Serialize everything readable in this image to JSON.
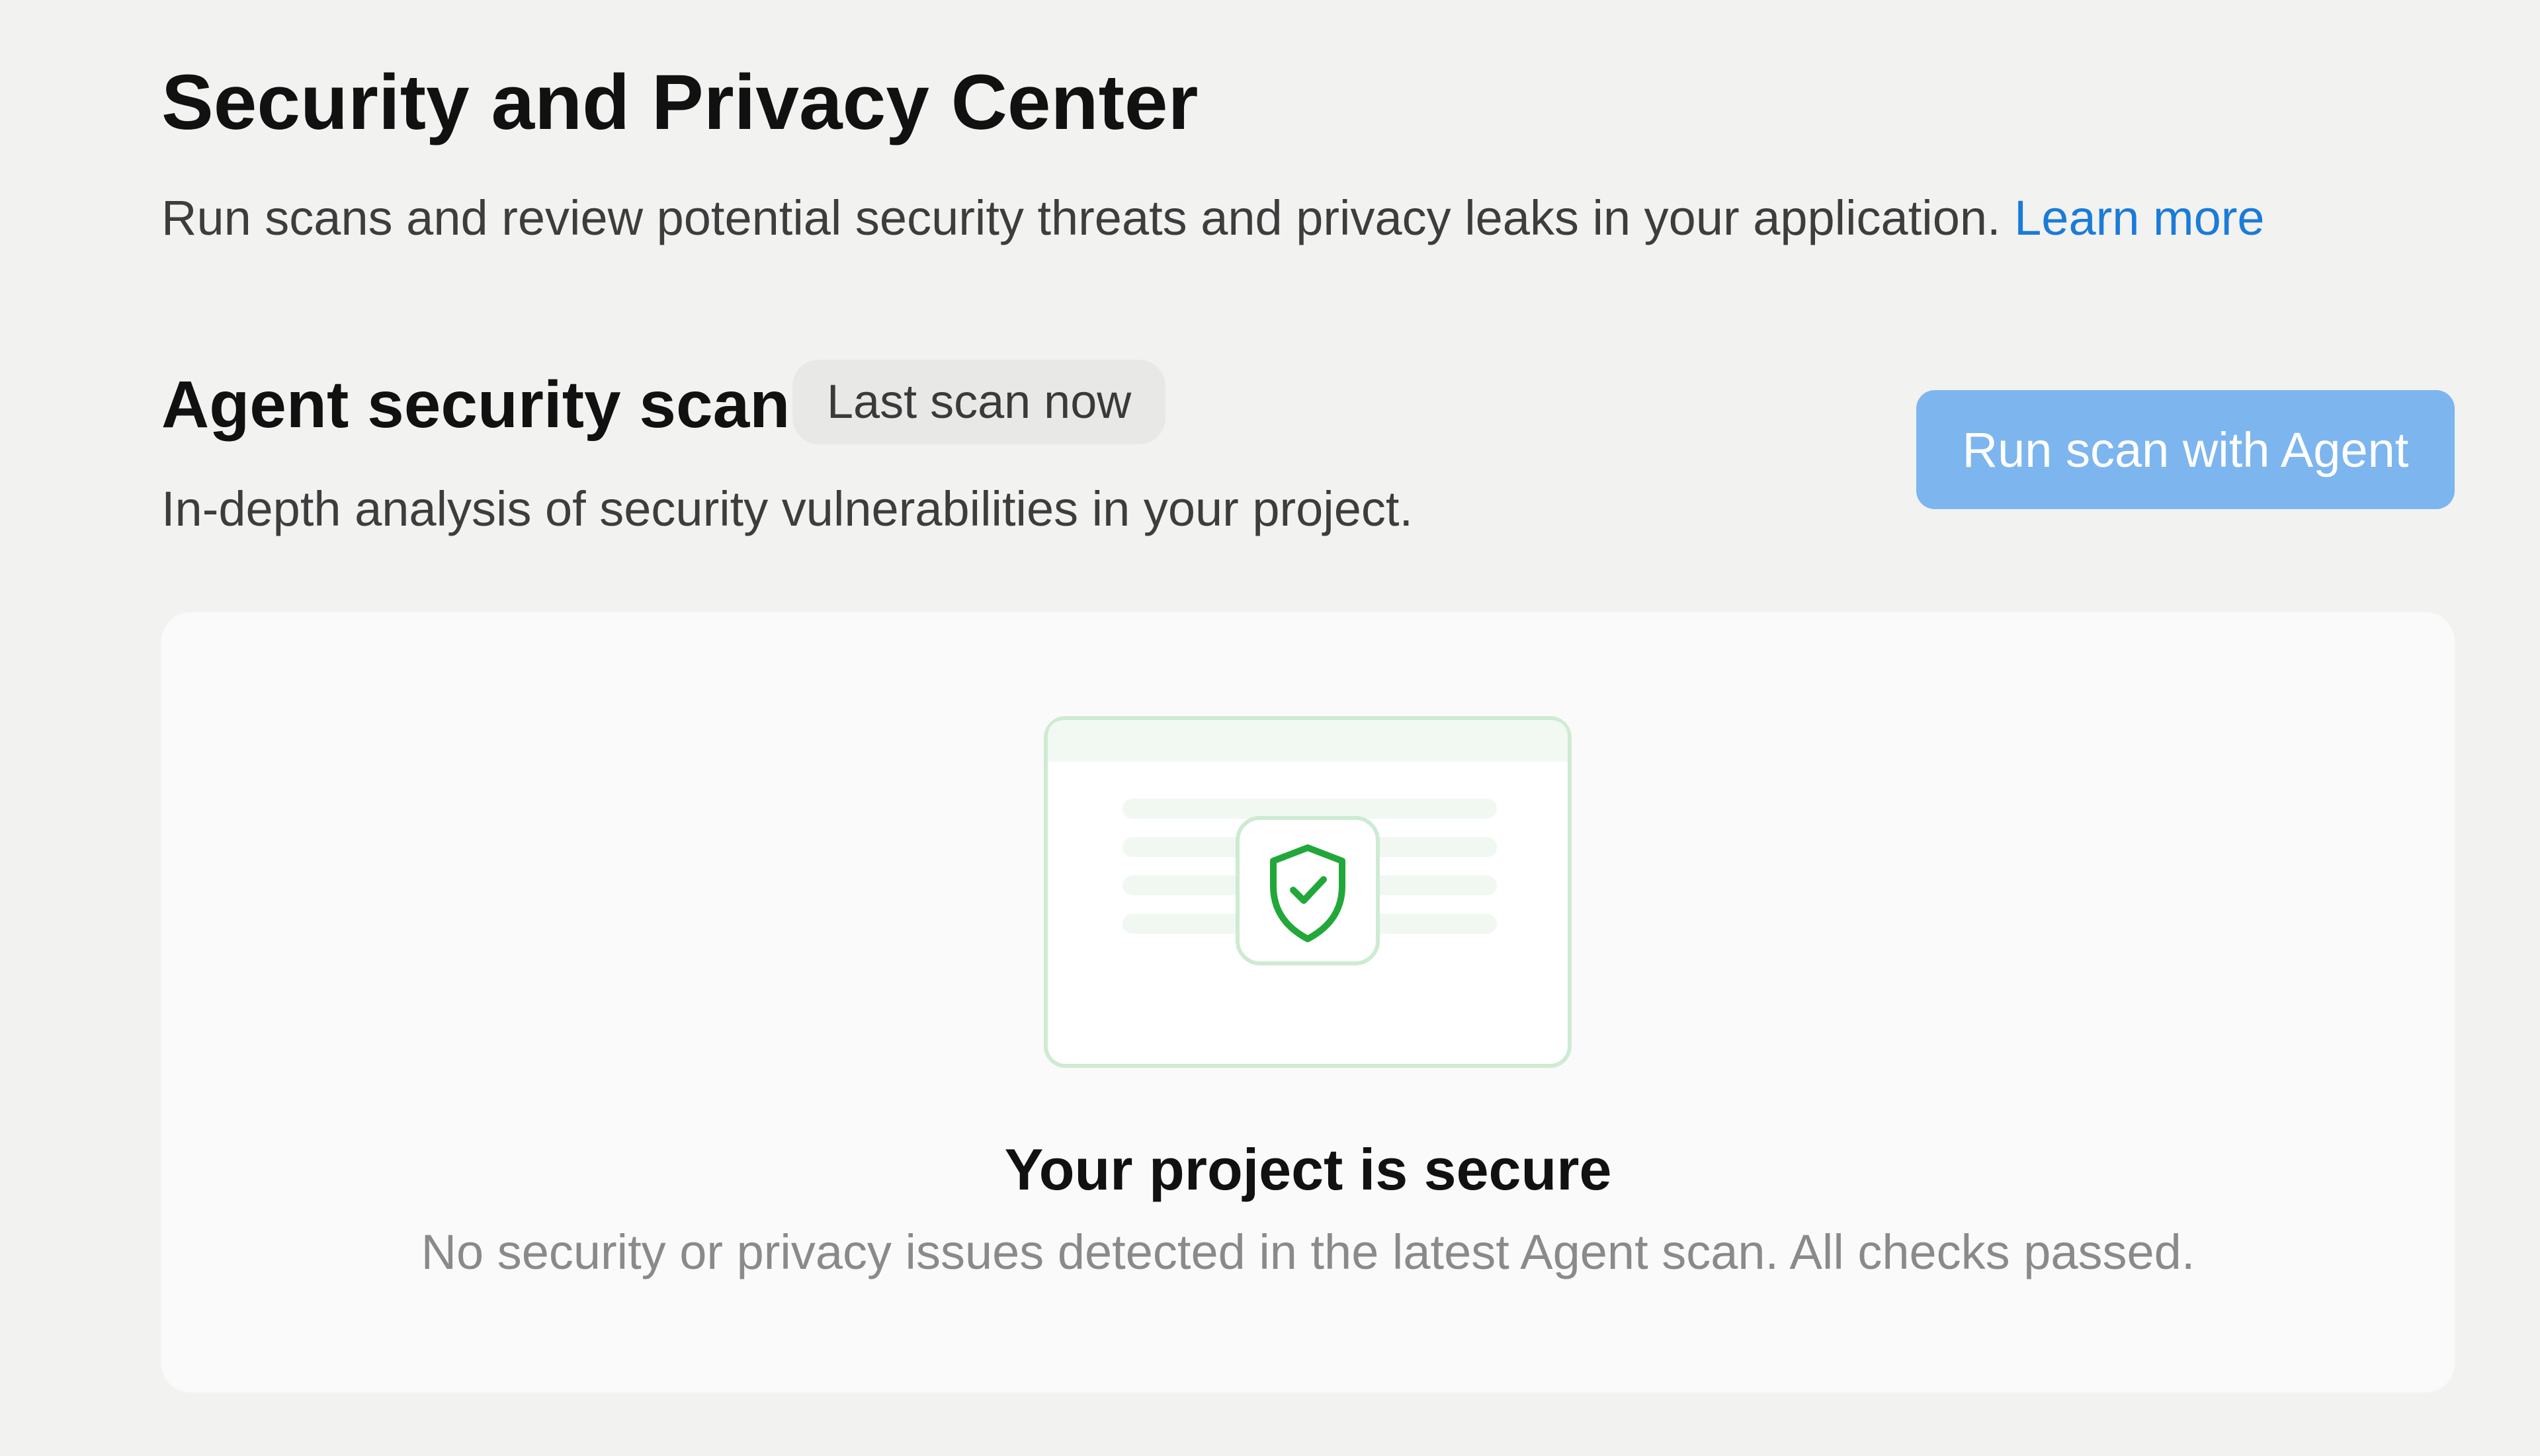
{
  "header": {
    "title": "Security and Privacy Center",
    "description": "Run scans and review potential security threats and privacy leaks in your application.",
    "learn_more_label": "Learn more"
  },
  "agent_scan": {
    "title": "Agent security scan",
    "last_scan_badge": "Last scan now",
    "description": "In-depth analysis of security vulnerabilities in your project.",
    "run_button_label": "Run scan with Agent"
  },
  "result": {
    "icon": "shield-check-icon",
    "title": "Your project is secure",
    "description": "No security or privacy issues detected in the latest Agent scan. All checks passed."
  },
  "colors": {
    "background": "#f2f2f1",
    "link": "#1a7bd8",
    "button": "#7db5ef",
    "success": "#22a83a"
  }
}
